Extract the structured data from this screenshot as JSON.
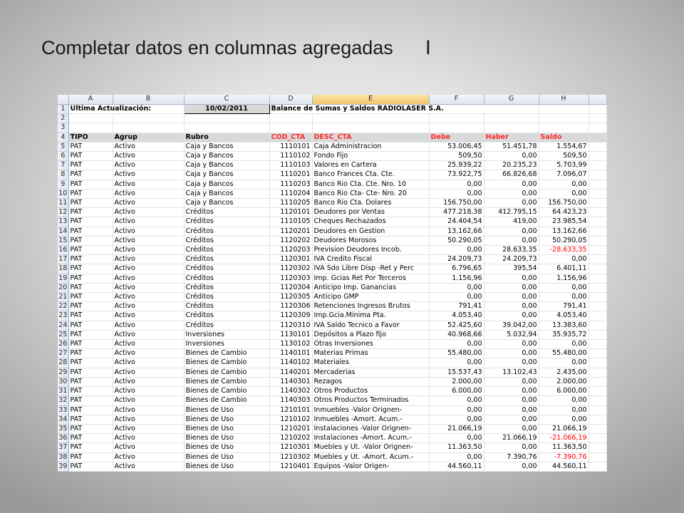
{
  "slide": {
    "title": "Completar datos en columnas agregadas",
    "cursor": "I"
  },
  "sheet": {
    "columns": [
      "A",
      "B",
      "C",
      "D",
      "E",
      "F",
      "G",
      "H"
    ],
    "row1": {
      "label_update": "Ultima Actualización:",
      "date": "10/02/2011",
      "report_title": "Balance de Sumas y Saldos RADIOLASER S.A."
    },
    "headers": {
      "tipo": "TIPO",
      "agrup": "Agrup",
      "rubro": "Rubro",
      "cod": "COD_CTA",
      "desc": "DESC_CTA",
      "debe": "Debe",
      "haber": "Haber",
      "saldo": "Saldo"
    },
    "row_numbers": {
      "r1": "1",
      "r2": "2",
      "r3": "3",
      "r4": "4"
    },
    "rows": [
      {
        "n": "5",
        "tipo": "PAT",
        "agrup": "Activo",
        "rubro": "Caja y Bancos",
        "cod": "1110101",
        "desc": "Caja Administracion",
        "debe": "53.006,45",
        "haber": "51.451,78",
        "saldo": "1.554,67",
        "neg": false
      },
      {
        "n": "6",
        "tipo": "PAT",
        "agrup": "Activo",
        "rubro": "Caja y Bancos",
        "cod": "1110102",
        "desc": "Fondo Fijo",
        "debe": "509,50",
        "haber": "0,00",
        "saldo": "509,50",
        "neg": false
      },
      {
        "n": "7",
        "tipo": "PAT",
        "agrup": "Activo",
        "rubro": "Caja y Bancos",
        "cod": "1110103",
        "desc": "Valores en Cartera",
        "debe": "25.939,22",
        "haber": "20.235,23",
        "saldo": "5.703,99",
        "neg": false
      },
      {
        "n": "8",
        "tipo": "PAT",
        "agrup": "Activo",
        "rubro": "Caja y Bancos",
        "cod": "1110201",
        "desc": "Banco Frances Cta. Cte.",
        "debe": "73.922,75",
        "haber": "66.826,68",
        "saldo": "7.096,07",
        "neg": false
      },
      {
        "n": "9",
        "tipo": "PAT",
        "agrup": "Activo",
        "rubro": "Caja y Bancos",
        "cod": "1110203",
        "desc": "Banco Rio Cta. Cte. Nro. 10",
        "debe": "0,00",
        "haber": "0,00",
        "saldo": "0,00",
        "neg": false
      },
      {
        "n": "10",
        "tipo": "PAT",
        "agrup": "Activo",
        "rubro": "Caja y Bancos",
        "cod": "1110204",
        "desc": "Banco Rio Cta- Cte- Nro. 20",
        "debe": "0,00",
        "haber": "0,00",
        "saldo": "0,00",
        "neg": false
      },
      {
        "n": "11",
        "tipo": "PAT",
        "agrup": "Activo",
        "rubro": "Caja y Bancos",
        "cod": "1110205",
        "desc": "Banco Rio Cta. Dolares",
        "debe": "156.750,00",
        "haber": "0,00",
        "saldo": "156.750,00",
        "neg": false
      },
      {
        "n": "12",
        "tipo": "PAT",
        "agrup": "Activo",
        "rubro": "Créditos",
        "cod": "1120101",
        "desc": "Deudores por Ventas",
        "debe": "477.218,38",
        "haber": "412.795,15",
        "saldo": "64.423,23",
        "neg": false
      },
      {
        "n": "13",
        "tipo": "PAT",
        "agrup": "Activo",
        "rubro": "Créditos",
        "cod": "1110105",
        "desc": "Cheques Rechazados",
        "debe": "24.404,54",
        "haber": "419,00",
        "saldo": "23.985,54",
        "neg": false
      },
      {
        "n": "14",
        "tipo": "PAT",
        "agrup": "Activo",
        "rubro": "Créditos",
        "cod": "1120201",
        "desc": "Deudores en Gestion",
        "debe": "13.162,66",
        "haber": "0,00",
        "saldo": "13.162,66",
        "neg": false
      },
      {
        "n": "15",
        "tipo": "PAT",
        "agrup": "Activo",
        "rubro": "Créditos",
        "cod": "1120202",
        "desc": "Deudores Morosos",
        "debe": "50.290,05",
        "haber": "0,00",
        "saldo": "50.290,05",
        "neg": false
      },
      {
        "n": "16",
        "tipo": "PAT",
        "agrup": "Activo",
        "rubro": "Créditos",
        "cod": "1120203",
        "desc": "Prevision Deudores Incob.",
        "debe": "0,00",
        "haber": "28.633,35",
        "saldo": "-28.633,35",
        "neg": true
      },
      {
        "n": "17",
        "tipo": "PAT",
        "agrup": "Activo",
        "rubro": "Créditos",
        "cod": "1120301",
        "desc": "IVA Credito Fiscal",
        "debe": "24.209,73",
        "haber": "24.209,73",
        "saldo": "0,00",
        "neg": false
      },
      {
        "n": "18",
        "tipo": "PAT",
        "agrup": "Activo",
        "rubro": "Créditos",
        "cod": "1120302",
        "desc": "IVA Sdo Libre Disp -Ret y Perc",
        "debe": "6.796,65",
        "haber": "395,54",
        "saldo": "6.401,11",
        "neg": false
      },
      {
        "n": "19",
        "tipo": "PAT",
        "agrup": "Activo",
        "rubro": "Créditos",
        "cod": "1120303",
        "desc": "Imp. Gcias Ret Por Terceros",
        "debe": "1.156,96",
        "haber": "0,00",
        "saldo": "1.156,96",
        "neg": false
      },
      {
        "n": "20",
        "tipo": "PAT",
        "agrup": "Activo",
        "rubro": "Créditos",
        "cod": "1120304",
        "desc": "Anticipo Imp. Ganancias",
        "debe": "0,00",
        "haber": "0,00",
        "saldo": "0,00",
        "neg": false
      },
      {
        "n": "21",
        "tipo": "PAT",
        "agrup": "Activo",
        "rubro": "Créditos",
        "cod": "1120305",
        "desc": "Anticipo GMP",
        "debe": "0,00",
        "haber": "0,00",
        "saldo": "0,00",
        "neg": false
      },
      {
        "n": "22",
        "tipo": "PAT",
        "agrup": "Activo",
        "rubro": "Créditos",
        "cod": "1120306",
        "desc": "Retenciones Ingresos Brutos",
        "debe": "791,41",
        "haber": "0,00",
        "saldo": "791,41",
        "neg": false
      },
      {
        "n": "23",
        "tipo": "PAT",
        "agrup": "Activo",
        "rubro": "Créditos",
        "cod": "1120309",
        "desc": "Imp.Gcia.Minima Pta.",
        "debe": "4.053,40",
        "haber": "0,00",
        "saldo": "4.053,40",
        "neg": false
      },
      {
        "n": "24",
        "tipo": "PAT",
        "agrup": "Activo",
        "rubro": "Créditos",
        "cod": "1120310",
        "desc": "IVA Saldo Tecnico a Favor",
        "debe": "52.425,60",
        "haber": "39.042,00",
        "saldo": "13.383,60",
        "neg": false
      },
      {
        "n": "25",
        "tipo": "PAT",
        "agrup": "Activo",
        "rubro": "Inversiones",
        "cod": "1130101",
        "desc": "Depósitos a Plazo fijo",
        "debe": "40.968,66",
        "haber": "5.032,94",
        "saldo": "35.935,72",
        "neg": false
      },
      {
        "n": "26",
        "tipo": "PAT",
        "agrup": "Activo",
        "rubro": "Inversiones",
        "cod": "1130102",
        "desc": "Otras Inversiones",
        "debe": "0,00",
        "haber": "0,00",
        "saldo": "0,00",
        "neg": false
      },
      {
        "n": "27",
        "tipo": "PAT",
        "agrup": "Activo",
        "rubro": "Bienes de Cambio",
        "cod": "1140101",
        "desc": "Materias Primas",
        "debe": "55.480,00",
        "haber": "0,00",
        "saldo": "55.480,00",
        "neg": false
      },
      {
        "n": "28",
        "tipo": "PAT",
        "agrup": "Activo",
        "rubro": "Bienes de Cambio",
        "cod": "1140102",
        "desc": "Materiales",
        "debe": "0,00",
        "haber": "0,00",
        "saldo": "0,00",
        "neg": false
      },
      {
        "n": "29",
        "tipo": "PAT",
        "agrup": "Activo",
        "rubro": "Bienes de Cambio",
        "cod": "1140201",
        "desc": "Mercaderias",
        "debe": "15.537,43",
        "haber": "13.102,43",
        "saldo": "2.435,00",
        "neg": false
      },
      {
        "n": "30",
        "tipo": "PAT",
        "agrup": "Activo",
        "rubro": "Bienes de Cambio",
        "cod": "1140301",
        "desc": "Rezagos",
        "debe": "2.000,00",
        "haber": "0,00",
        "saldo": "2.000,00",
        "neg": false
      },
      {
        "n": "31",
        "tipo": "PAT",
        "agrup": "Activo",
        "rubro": "Bienes de Cambio",
        "cod": "1140302",
        "desc": "Otros Productos",
        "debe": "6.000,00",
        "haber": "0,00",
        "saldo": "6.000,00",
        "neg": false
      },
      {
        "n": "32",
        "tipo": "PAT",
        "agrup": "Activo",
        "rubro": "Bienes de Cambio",
        "cod": "1140303",
        "desc": "Otros Productos Terminados",
        "debe": "0,00",
        "haber": "0,00",
        "saldo": "0,00",
        "neg": false
      },
      {
        "n": "33",
        "tipo": "PAT",
        "agrup": "Activo",
        "rubro": "Bienes de Uso",
        "cod": "1210101",
        "desc": "Inmuebles -Valor Orignen-",
        "debe": "0,00",
        "haber": "0,00",
        "saldo": "0,00",
        "neg": false
      },
      {
        "n": "34",
        "tipo": "PAT",
        "agrup": "Activo",
        "rubro": "Bienes de Uso",
        "cod": "1210102",
        "desc": "Inmuebles -Amort. Acum.-",
        "debe": "0,00",
        "haber": "0,00",
        "saldo": "0,00",
        "neg": false
      },
      {
        "n": "35",
        "tipo": "PAT",
        "agrup": "Activo",
        "rubro": "Bienes de Uso",
        "cod": "1210201",
        "desc": "Instalaciones -Valor Orignen-",
        "debe": "21.066,19",
        "haber": "0,00",
        "saldo": "21.066,19",
        "neg": false
      },
      {
        "n": "36",
        "tipo": "PAT",
        "agrup": "Activo",
        "rubro": "Bienes de Uso",
        "cod": "1210202",
        "desc": "Instalaciones -Amort. Acum.-",
        "debe": "0,00",
        "haber": "21.066,19",
        "saldo": "-21.066,19",
        "neg": true
      },
      {
        "n": "37",
        "tipo": "PAT",
        "agrup": "Activo",
        "rubro": "Bienes de Uso",
        "cod": "1210301",
        "desc": "Muebles y Ut. -Valor Orignen-",
        "debe": "11.363,50",
        "haber": "0,00",
        "saldo": "11.363,50",
        "neg": false
      },
      {
        "n": "38",
        "tipo": "PAT",
        "agrup": "Activo",
        "rubro": "Bienes de Uso",
        "cod": "1210302",
        "desc": "Muebles y Ut. -Amort. Acum.-",
        "debe": "0,00",
        "haber": "7.390,76",
        "saldo": "-7.390,76",
        "neg": true
      },
      {
        "n": "39",
        "tipo": "PAT",
        "agrup": "Activo",
        "rubro": "Bienes de Uso",
        "cod": "1210401",
        "desc": "Equipos -Valor Origen-",
        "debe": "44.560,11",
        "haber": "0,00",
        "saldo": "44.560,11",
        "neg": false
      }
    ]
  }
}
